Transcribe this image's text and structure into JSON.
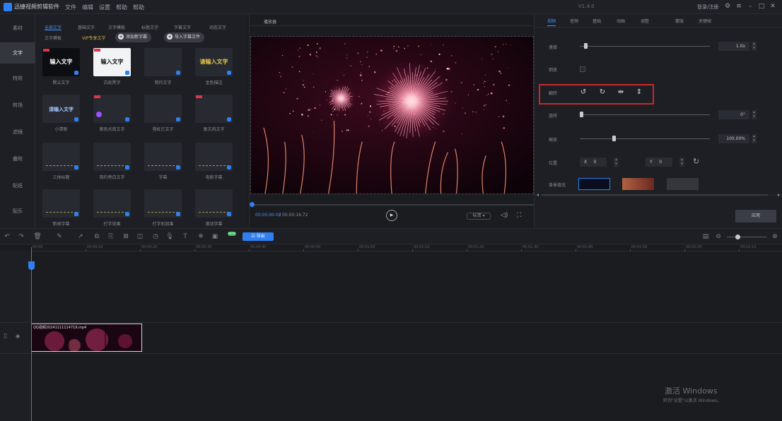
{
  "app": {
    "title": "迅捷视频剪辑软件",
    "menus": [
      "文件",
      "编辑",
      "设置",
      "帮助",
      "帮助"
    ],
    "version": "V1.4.0",
    "login": "登录/注册"
  },
  "leftnav": {
    "items": [
      {
        "label": "素材",
        "active": false
      },
      {
        "label": "文字",
        "active": true
      },
      {
        "label": "特效",
        "active": false
      },
      {
        "label": "转场",
        "active": false
      },
      {
        "label": "滤镜",
        "active": false
      },
      {
        "label": "叠附",
        "active": false
      },
      {
        "label": "贴纸",
        "active": false
      },
      {
        "label": "配乐",
        "active": false
      }
    ]
  },
  "library": {
    "tabs": [
      "全部文字",
      "基础文字",
      "文字模板",
      "标题文字",
      "字幕文字",
      "动态文字"
    ],
    "subtabs": [
      "文字模板",
      "VIP专享文字"
    ],
    "buttons": {
      "import_text": "添加新字幕",
      "import_subtitle": "导入字幕文件"
    },
    "tiles": [
      {
        "caption": "默认文字",
        "text": "输入文字",
        "style": "plain-dark"
      },
      {
        "caption": "白底黑字",
        "text": "输入文字",
        "style": "white"
      },
      {
        "caption": "简约文字",
        "text": "",
        "style": "empty"
      },
      {
        "caption": "金色描边",
        "text": "请输入文字",
        "style": "gold"
      },
      {
        "caption": "小清新",
        "text": "请输入文字",
        "style": "blue"
      },
      {
        "caption": "紫色光效文字",
        "text": "",
        "style": "purple"
      },
      {
        "caption": "霓虹灯文字",
        "text": "",
        "style": "empty"
      },
      {
        "caption": "复古风文字",
        "text": "",
        "style": "empty-red"
      },
      {
        "caption": "三体标题",
        "text": "",
        "style": "line"
      },
      {
        "caption": "简约旁白文字",
        "text": "",
        "style": "line"
      },
      {
        "caption": "字幕",
        "text": "",
        "style": "line"
      },
      {
        "caption": "电影字幕",
        "text": "",
        "style": "line"
      },
      {
        "caption": "新闻字幕",
        "text": "",
        "style": "line-small"
      },
      {
        "caption": "打字效果",
        "text": "",
        "style": "line-small"
      },
      {
        "caption": "打字机效果",
        "text": "",
        "style": "line-small"
      },
      {
        "caption": "滚动字幕",
        "text": "",
        "style": "line-small"
      }
    ]
  },
  "player": {
    "tab": "播放器",
    "timecode_current": "00:00:00.00",
    "timecode_total": "00:00:16.72",
    "quality": "标清 ▾",
    "progress": 0
  },
  "props": {
    "tabs": [
      "视频",
      "音频",
      "基础",
      "动画",
      "调整",
      "蒙版",
      "关键帧"
    ],
    "speed": {
      "label": "速度",
      "value": "1.0x",
      "level": 0.03
    },
    "reverse": {
      "label": "倒放"
    },
    "flip": {
      "label": "翻转",
      "icons": [
        "rotate-left-icon",
        "rotate-right-icon",
        "flip-horizontal-icon",
        "flip-vertical-icon"
      ]
    },
    "rotate": {
      "label": "旋转",
      "value": "0°",
      "level": 0.0
    },
    "scale": {
      "label": "缩放",
      "value": "100.00%",
      "level": 0.25
    },
    "position": {
      "label": "位置",
      "x_label": "X",
      "x": "0",
      "y_label": "Y",
      "y": "0"
    },
    "background": {
      "label": "背景填充",
      "swatches": [
        "#0a0e1e",
        "#b06040",
        "#35373c"
      ]
    },
    "apply_label": "应用"
  },
  "timeline": {
    "toolbar_blue": "☑ 导出",
    "new_badge": "NEW",
    "ruler_ticks": [
      "00:00",
      "00:00:10",
      "00:00:20",
      "00:00:30",
      "00:00:40",
      "00:00:50",
      "00:01:00",
      "00:01:10",
      "00:01:20",
      "00:01:30",
      "00:01:40",
      "00:01:50",
      "00:02:00",
      "00:02:10"
    ],
    "clip_name": "QQ视频20241111114719.mp4"
  },
  "watermark": {
    "line1": "激活 Windows",
    "line2": "转到\"设置\"以激活 Windows。"
  },
  "colors": {
    "accent": "#2f7ff0",
    "highlight_box": "#c8282c"
  }
}
